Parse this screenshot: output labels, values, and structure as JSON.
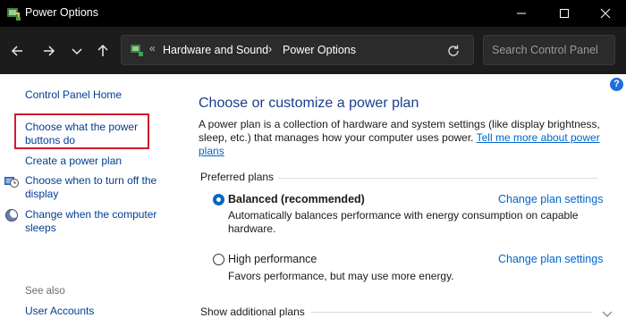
{
  "window": {
    "title": "Power Options"
  },
  "nav": {
    "breadcrumbs": [
      "Hardware and Sound",
      "Power Options"
    ],
    "overflow_glyph": "«",
    "separator": "›",
    "search_placeholder": "Search Control Panel"
  },
  "sidebar": {
    "home": "Control Panel Home",
    "links": [
      "Choose what the power buttons do",
      "Create a power plan",
      "Choose when to turn off the display",
      "Change when the computer sleeps"
    ],
    "see_also_label": "See also",
    "see_also_links": [
      "User Accounts"
    ]
  },
  "main": {
    "help_glyph": "?",
    "title": "Choose or customize a power plan",
    "intro_text": "A power plan is a collection of hardware and system settings (like display brightness, sleep, etc.) that manages how your computer uses power. ",
    "intro_link": "Tell me more about power plans",
    "preferred_label": "Preferred plans",
    "plans": [
      {
        "name": "Balanced (recommended)",
        "description": "Automatically balances performance with energy consumption on capable hardware.",
        "selected": true,
        "change_link": "Change plan settings"
      },
      {
        "name": "High performance",
        "description": "Favors performance, but may use more energy.",
        "selected": false,
        "change_link": "Change plan settings"
      }
    ],
    "show_additional": "Show additional plans"
  },
  "colors": {
    "titlebar_bg": "#000000",
    "navbar_bg": "#1c1c1c",
    "sidebar_link": "#003e92",
    "main_link": "#0066cc",
    "title_blue": "#1a3e8a",
    "highlight": "#d11a2a",
    "radio_selected": "#0067c0"
  }
}
